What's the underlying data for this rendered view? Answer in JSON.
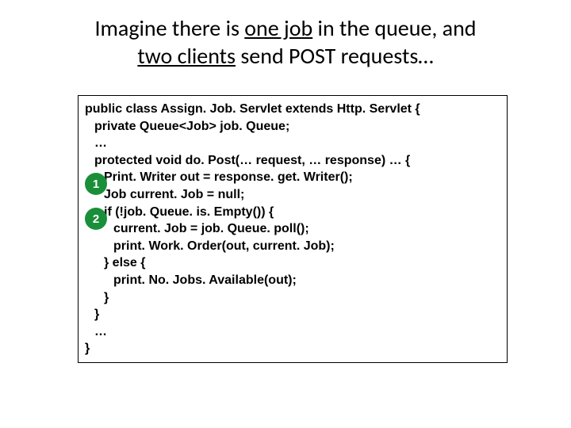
{
  "title": {
    "line1_pre": "Imagine there is ",
    "line1_u": "one job",
    "line1_post": " in the queue, and",
    "line2_u": "two clients",
    "line2_post": " send POST requests…"
  },
  "code": {
    "l01": "public class Assign. Job. Servlet extends Http. Servlet {",
    "l02": "private Queue<Job> job. Queue;",
    "l03": "…",
    "l04": "protected void do. Post(… request, … response) … {",
    "l05": "Print. Writer out = response. get. Writer();",
    "l06": "Job current. Job = null;",
    "l07": "if (!job. Queue. is. Empty()) {",
    "l08": "current. Job = job. Queue. poll();",
    "l09": "print. Work. Order(out, current. Job);",
    "l10": "} else {",
    "l11": "print. No. Jobs. Available(out);",
    "l12": "}",
    "l13": "}",
    "l14": "…",
    "l15": "}"
  },
  "badges": {
    "one": "1",
    "two": "2"
  }
}
